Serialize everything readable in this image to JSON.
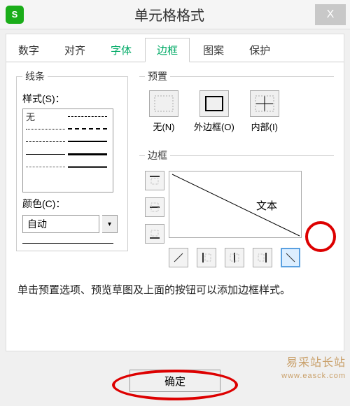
{
  "titlebar": {
    "title": "单元格格式",
    "close": "X"
  },
  "tabs": [
    "数字",
    "对齐",
    "字体",
    "边框",
    "图案",
    "保护"
  ],
  "active_tab_index": 3,
  "line": {
    "legend": "线条",
    "style_label": "样式(S)：",
    "none_text": "无",
    "color_label": "颜色(C)：",
    "color_value": "自动"
  },
  "preset": {
    "legend": "预置",
    "items": [
      {
        "label": "无(N)"
      },
      {
        "label": "外边框(O)"
      },
      {
        "label": "内部(I)"
      }
    ]
  },
  "border": {
    "legend": "边框",
    "sample_text": "文本"
  },
  "hint": "单击预置选项、预览草图及上面的按钮可以添加边框样式。",
  "footer": {
    "ok": "确定"
  },
  "watermark": {
    "line1": "易采站长站",
    "line2": "www.easck.com"
  }
}
